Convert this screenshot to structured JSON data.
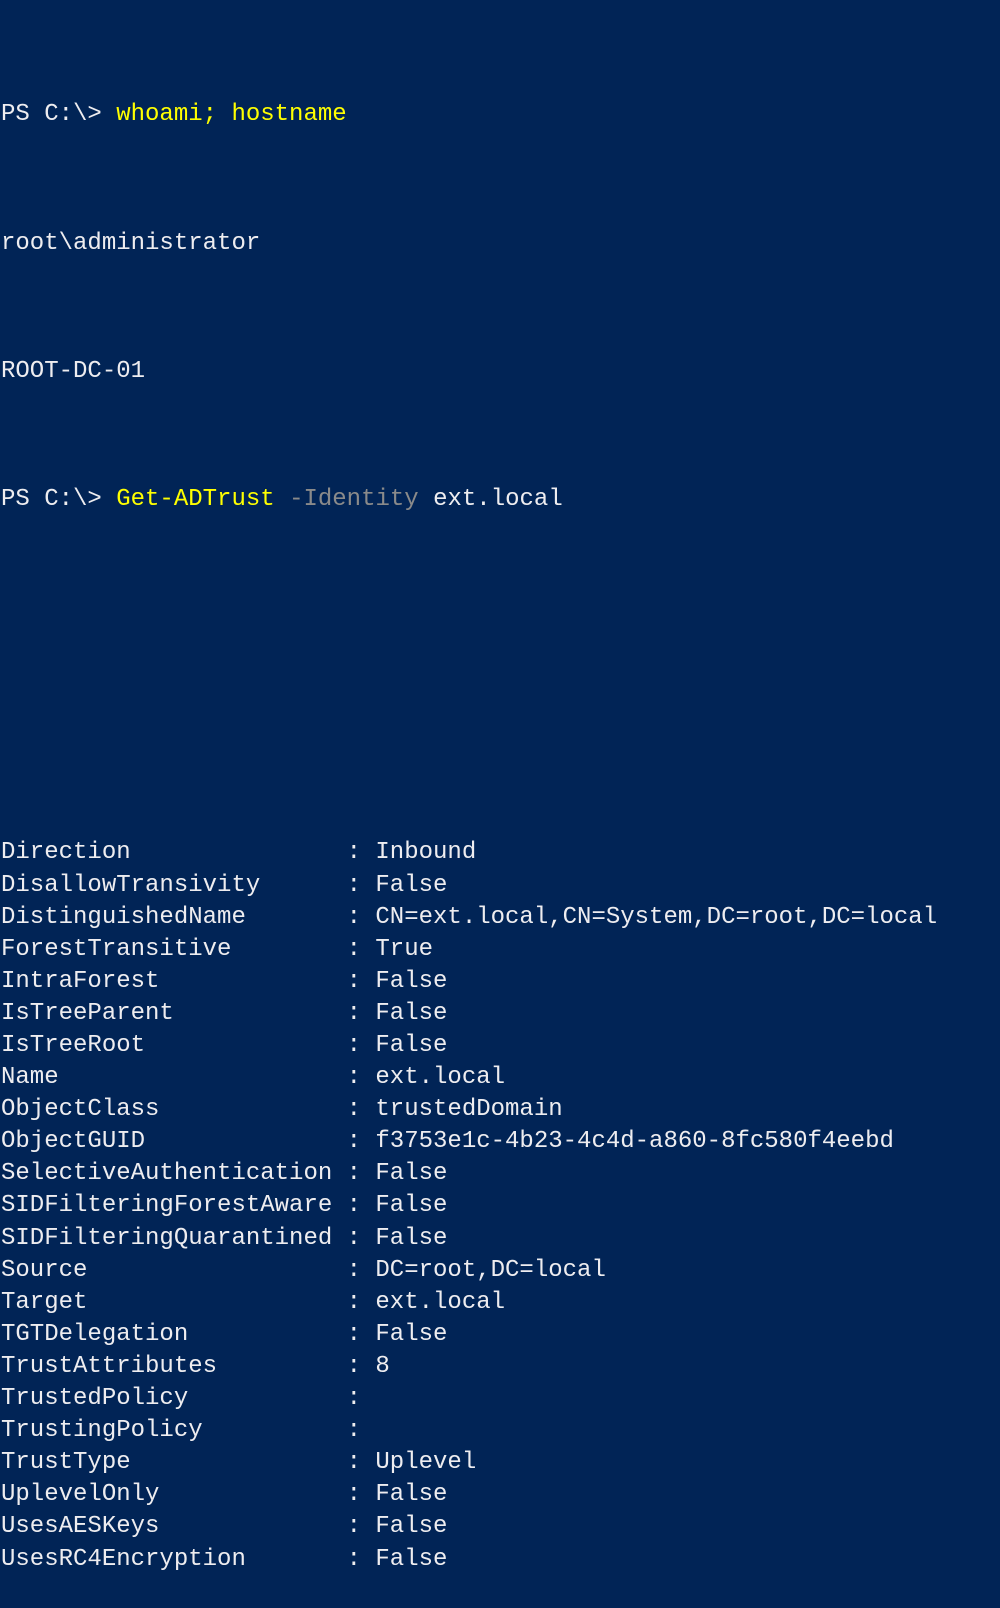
{
  "window": {
    "background_color": "#012456",
    "foreground_color": "#EEEDF0",
    "command_color": "#FFFF00",
    "parameter_color": "#8A8A8A"
  },
  "session": [
    {
      "type": "command",
      "prompt": "PS C:\\> ",
      "tokens": [
        {
          "kind": "cmd",
          "text": "whoami; hostname"
        }
      ]
    },
    {
      "type": "output",
      "text": "root\\administrator"
    },
    {
      "type": "output",
      "text": "ROOT-DC-01"
    },
    {
      "type": "command",
      "prompt": "PS C:\\> ",
      "tokens": [
        {
          "kind": "cmd",
          "text": "Get-ADTrust"
        },
        {
          "kind": "space",
          "text": " "
        },
        {
          "kind": "param",
          "text": "-Identity"
        },
        {
          "kind": "space",
          "text": " "
        },
        {
          "kind": "arg",
          "text": "ext.local"
        }
      ]
    }
  ],
  "trust_properties": [
    {
      "name": "Direction",
      "value": "Inbound"
    },
    {
      "name": "DisallowTransivity",
      "value": "False"
    },
    {
      "name": "DistinguishedName",
      "value": "CN=ext.local,CN=System,DC=root,DC=local"
    },
    {
      "name": "ForestTransitive",
      "value": "True"
    },
    {
      "name": "IntraForest",
      "value": "False"
    },
    {
      "name": "IsTreeParent",
      "value": "False"
    },
    {
      "name": "IsTreeRoot",
      "value": "False"
    },
    {
      "name": "Name",
      "value": "ext.local"
    },
    {
      "name": "ObjectClass",
      "value": "trustedDomain"
    },
    {
      "name": "ObjectGUID",
      "value": "f3753e1c-4b23-4c4d-a860-8fc580f4eebd"
    },
    {
      "name": "SelectiveAuthentication",
      "value": "False"
    },
    {
      "name": "SIDFilteringForestAware",
      "value": "False"
    },
    {
      "name": "SIDFilteringQuarantined",
      "value": "False"
    },
    {
      "name": "Source",
      "value": "DC=root,DC=local"
    },
    {
      "name": "Target",
      "value": "ext.local"
    },
    {
      "name": "TGTDelegation",
      "value": "False"
    },
    {
      "name": "TrustAttributes",
      "value": "8"
    },
    {
      "name": "TrustedPolicy",
      "value": ""
    },
    {
      "name": "TrustingPolicy",
      "value": ""
    },
    {
      "name": "TrustType",
      "value": "Uplevel"
    },
    {
      "name": "UplevelOnly",
      "value": "False"
    },
    {
      "name": "UsesAESKeys",
      "value": "False"
    },
    {
      "name": "UsesRC4Encryption",
      "value": "False"
    }
  ],
  "separator": ": "
}
